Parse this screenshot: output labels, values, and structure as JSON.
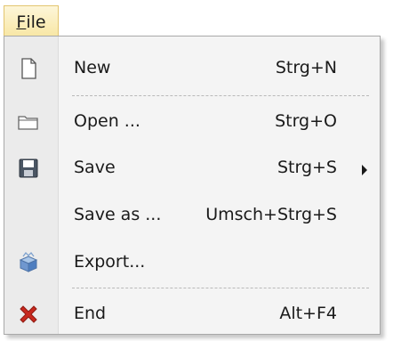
{
  "menubar": {
    "file_first": "F",
    "file_rest": "ile"
  },
  "menu": {
    "items": [
      {
        "label": "New",
        "shortcut": "Strg+N",
        "icon": "new-document-icon"
      },
      {
        "label": "Open ...",
        "shortcut": "Strg+O",
        "icon": "open-folder-icon"
      },
      {
        "label": "Save",
        "shortcut": "Strg+S",
        "icon": "save-disk-icon",
        "submenu_arrow": true
      },
      {
        "label": "Save as ...",
        "shortcut": "Umsch+Strg+S",
        "icon": ""
      },
      {
        "label": "Export...",
        "shortcut": "",
        "icon": "export-box-icon"
      },
      {
        "label": "End",
        "shortcut": "Alt+F4",
        "icon": "close-x-icon"
      }
    ]
  },
  "colors": {
    "menu_background": "#f4f4f4",
    "gutter": "#ebebeb",
    "highlight": "#f8e7a6",
    "close_red": "#c8281e"
  }
}
